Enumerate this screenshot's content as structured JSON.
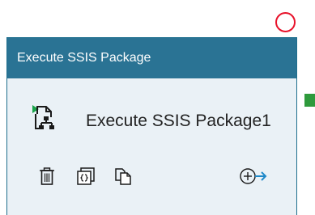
{
  "activity": {
    "header_title": "Execute SSIS Package",
    "name": "Execute SSIS Package1"
  },
  "icons": {
    "activity_type": "ssis-package-icon",
    "delete": "trash-icon",
    "code": "code-icon",
    "clone": "copy-icon",
    "add_output": "add-output-arrow-icon",
    "status": "error-status-circle"
  },
  "colors": {
    "header_bg": "#2a7394",
    "body_bg": "#eaf1f6",
    "status_error": "#e8132b",
    "connector_success": "#2e9a3c",
    "accent": "#1e88c8"
  }
}
